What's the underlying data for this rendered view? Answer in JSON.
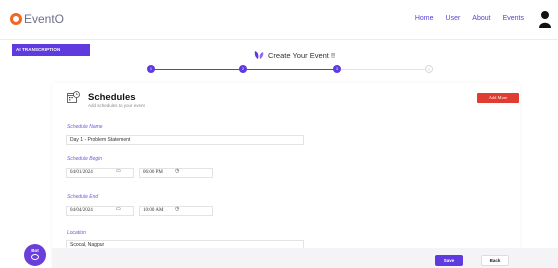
{
  "app": {
    "logo_text": "EventO",
    "brand_color": "#f26522",
    "accent_color": "#5f3bdf"
  },
  "nav": {
    "items": [
      {
        "label": "Home"
      },
      {
        "label": "User"
      },
      {
        "label": "About"
      },
      {
        "label": "Events"
      }
    ],
    "user_icon": "user-icon"
  },
  "sidebar": {
    "ai_tab_label": "AI TRANSCRIPTION"
  },
  "wizard": {
    "title": "Create Your Event !!",
    "steps": [
      {
        "label": "1",
        "state": "complete"
      },
      {
        "label": "2",
        "state": "complete"
      },
      {
        "label": "3",
        "state": "current"
      },
      {
        "label": "4",
        "state": "pending"
      }
    ]
  },
  "section": {
    "title": "Schedules",
    "subtitle": "Add schedules to your event",
    "add_more_label": "Add More",
    "add_more_color": "#e03c31"
  },
  "form": {
    "schedule_name": {
      "label": "Schedule Name",
      "value": "Day 1 - Problem Statement"
    },
    "schedule_begin": {
      "label": "Schedule Begin",
      "date": "04/01/2024",
      "time": "06:00 PM"
    },
    "schedule_end": {
      "label": "Schedule End",
      "date": "04/04/2024",
      "time": "10:00 AM"
    },
    "location": {
      "label": "Location",
      "value": "Scocal, Nagpur"
    }
  },
  "footer": {
    "save_label": "Save",
    "back_label": "Back"
  },
  "bot": {
    "label": "Bot"
  }
}
